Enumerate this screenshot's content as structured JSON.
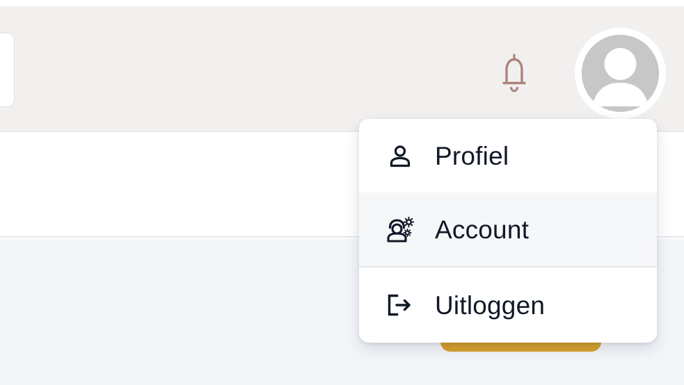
{
  "header": {
    "notification_icon": "bell-icon",
    "avatar_icon": "user-avatar-icon",
    "colors": {
      "background": "#f2f0ef",
      "bell": "#aa857d",
      "avatar": "#c7c7c7"
    }
  },
  "dropdown": {
    "items": [
      {
        "label": "Profiel",
        "icon": "user-icon"
      },
      {
        "label": "Account",
        "icon": "user-settings-icon"
      },
      {
        "label": "Uitloggen",
        "icon": "logout-icon"
      }
    ],
    "highlighted_item": "Account",
    "colors": {
      "text": "#111827",
      "highlight": "#f6f7f9"
    }
  },
  "background": {
    "accent_button_color": "#d6a02b",
    "lower_area_color": "#f3f5f9"
  }
}
